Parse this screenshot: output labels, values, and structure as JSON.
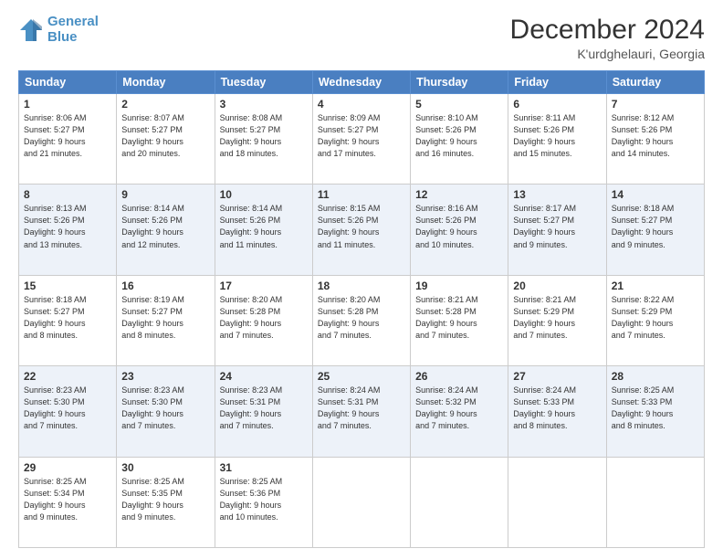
{
  "header": {
    "logo_line1": "General",
    "logo_line2": "Blue",
    "main_title": "December 2024",
    "subtitle": "K'urdghelauri, Georgia"
  },
  "days_of_week": [
    "Sunday",
    "Monday",
    "Tuesday",
    "Wednesday",
    "Thursday",
    "Friday",
    "Saturday"
  ],
  "weeks": [
    [
      {
        "day": "1",
        "info": "Sunrise: 8:06 AM\nSunset: 5:27 PM\nDaylight: 9 hours\nand 21 minutes."
      },
      {
        "day": "2",
        "info": "Sunrise: 8:07 AM\nSunset: 5:27 PM\nDaylight: 9 hours\nand 20 minutes."
      },
      {
        "day": "3",
        "info": "Sunrise: 8:08 AM\nSunset: 5:27 PM\nDaylight: 9 hours\nand 18 minutes."
      },
      {
        "day": "4",
        "info": "Sunrise: 8:09 AM\nSunset: 5:27 PM\nDaylight: 9 hours\nand 17 minutes."
      },
      {
        "day": "5",
        "info": "Sunrise: 8:10 AM\nSunset: 5:26 PM\nDaylight: 9 hours\nand 16 minutes."
      },
      {
        "day": "6",
        "info": "Sunrise: 8:11 AM\nSunset: 5:26 PM\nDaylight: 9 hours\nand 15 minutes."
      },
      {
        "day": "7",
        "info": "Sunrise: 8:12 AM\nSunset: 5:26 PM\nDaylight: 9 hours\nand 14 minutes."
      }
    ],
    [
      {
        "day": "8",
        "info": "Sunrise: 8:13 AM\nSunset: 5:26 PM\nDaylight: 9 hours\nand 13 minutes."
      },
      {
        "day": "9",
        "info": "Sunrise: 8:14 AM\nSunset: 5:26 PM\nDaylight: 9 hours\nand 12 minutes."
      },
      {
        "day": "10",
        "info": "Sunrise: 8:14 AM\nSunset: 5:26 PM\nDaylight: 9 hours\nand 11 minutes."
      },
      {
        "day": "11",
        "info": "Sunrise: 8:15 AM\nSunset: 5:26 PM\nDaylight: 9 hours\nand 11 minutes."
      },
      {
        "day": "12",
        "info": "Sunrise: 8:16 AM\nSunset: 5:26 PM\nDaylight: 9 hours\nand 10 minutes."
      },
      {
        "day": "13",
        "info": "Sunrise: 8:17 AM\nSunset: 5:27 PM\nDaylight: 9 hours\nand 9 minutes."
      },
      {
        "day": "14",
        "info": "Sunrise: 8:18 AM\nSunset: 5:27 PM\nDaylight: 9 hours\nand 9 minutes."
      }
    ],
    [
      {
        "day": "15",
        "info": "Sunrise: 8:18 AM\nSunset: 5:27 PM\nDaylight: 9 hours\nand 8 minutes."
      },
      {
        "day": "16",
        "info": "Sunrise: 8:19 AM\nSunset: 5:27 PM\nDaylight: 9 hours\nand 8 minutes."
      },
      {
        "day": "17",
        "info": "Sunrise: 8:20 AM\nSunset: 5:28 PM\nDaylight: 9 hours\nand 7 minutes."
      },
      {
        "day": "18",
        "info": "Sunrise: 8:20 AM\nSunset: 5:28 PM\nDaylight: 9 hours\nand 7 minutes."
      },
      {
        "day": "19",
        "info": "Sunrise: 8:21 AM\nSunset: 5:28 PM\nDaylight: 9 hours\nand 7 minutes."
      },
      {
        "day": "20",
        "info": "Sunrise: 8:21 AM\nSunset: 5:29 PM\nDaylight: 9 hours\nand 7 minutes."
      },
      {
        "day": "21",
        "info": "Sunrise: 8:22 AM\nSunset: 5:29 PM\nDaylight: 9 hours\nand 7 minutes."
      }
    ],
    [
      {
        "day": "22",
        "info": "Sunrise: 8:23 AM\nSunset: 5:30 PM\nDaylight: 9 hours\nand 7 minutes."
      },
      {
        "day": "23",
        "info": "Sunrise: 8:23 AM\nSunset: 5:30 PM\nDaylight: 9 hours\nand 7 minutes."
      },
      {
        "day": "24",
        "info": "Sunrise: 8:23 AM\nSunset: 5:31 PM\nDaylight: 9 hours\nand 7 minutes."
      },
      {
        "day": "25",
        "info": "Sunrise: 8:24 AM\nSunset: 5:31 PM\nDaylight: 9 hours\nand 7 minutes."
      },
      {
        "day": "26",
        "info": "Sunrise: 8:24 AM\nSunset: 5:32 PM\nDaylight: 9 hours\nand 7 minutes."
      },
      {
        "day": "27",
        "info": "Sunrise: 8:24 AM\nSunset: 5:33 PM\nDaylight: 9 hours\nand 8 minutes."
      },
      {
        "day": "28",
        "info": "Sunrise: 8:25 AM\nSunset: 5:33 PM\nDaylight: 9 hours\nand 8 minutes."
      }
    ],
    [
      {
        "day": "29",
        "info": "Sunrise: 8:25 AM\nSunset: 5:34 PM\nDaylight: 9 hours\nand 9 minutes."
      },
      {
        "day": "30",
        "info": "Sunrise: 8:25 AM\nSunset: 5:35 PM\nDaylight: 9 hours\nand 9 minutes."
      },
      {
        "day": "31",
        "info": "Sunrise: 8:25 AM\nSunset: 5:36 PM\nDaylight: 9 hours\nand 10 minutes."
      },
      null,
      null,
      null,
      null
    ]
  ]
}
